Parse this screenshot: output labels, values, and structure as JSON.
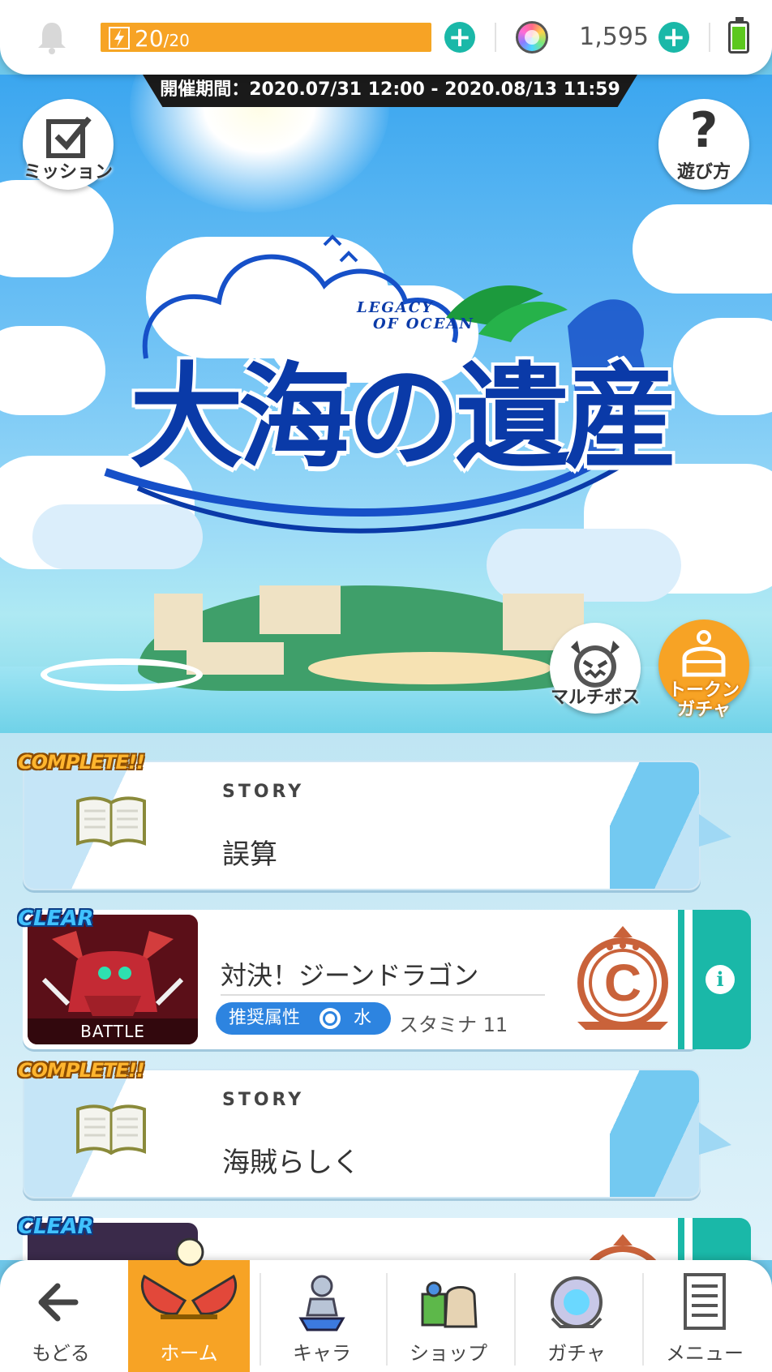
{
  "status_bar": {
    "stamina_current": "20",
    "stamina_max": "/20",
    "stamina_fraction": 1.0,
    "gems": "1,595",
    "battery_level": 0.82
  },
  "banner": {
    "period": "開催期間：2020.07/31 12:00 - 2020.08/13 11:59",
    "logo_title": "大海の遺産",
    "logo_subtitle_line1": "LEGACY",
    "logo_subtitle_line2": "OF OCEAN",
    "mission_label": "ミッション",
    "howto_label": "遊び方",
    "multi_boss_label": "マルチボス",
    "token_gacha_label": "トークン\nガチャ"
  },
  "quests": [
    {
      "badge": "COMPLETE!!",
      "type": "STORY",
      "title": "誤算"
    },
    {
      "badge": "CLEAR",
      "type": "BATTLE",
      "image_label": "BATTLE",
      "title": "対決！ジーンドラゴン",
      "attr_label": "推奨属性",
      "attr_value": "水",
      "stamina": "スタミナ 11",
      "rank": "C"
    },
    {
      "badge": "COMPLETE!!",
      "type": "STORY",
      "title": "海賊らしく"
    },
    {
      "badge": "CLEAR",
      "type": "BATTLE"
    }
  ],
  "nav": {
    "back": "もどる",
    "home": "ホーム",
    "chara": "キャラ",
    "shop": "ショップ",
    "gacha": "ガチャ",
    "menu": "メニュー"
  },
  "colors": {
    "accent_orange": "#f7a325",
    "accent_teal": "#1ab8a8",
    "logo_blue": "#0a3aa8",
    "attr_blue": "#2d84e0"
  }
}
